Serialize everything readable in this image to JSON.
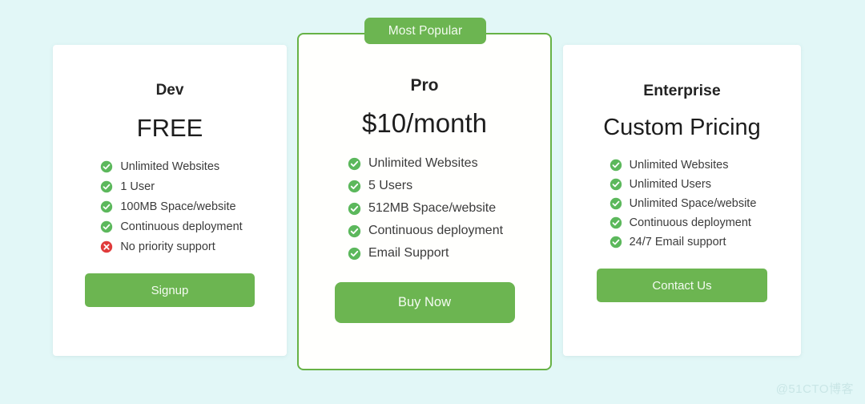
{
  "page": {
    "background_color": "#e2f7f7",
    "accent_green": "#6cb551",
    "border_green": "#67b246",
    "icon_check_color": "#5cb85c",
    "icon_cross_color": "#e03a3a",
    "watermark": "@51CTO博客"
  },
  "plans": [
    {
      "id": "dev",
      "name": "Dev",
      "price": "FREE",
      "featured": false,
      "features": [
        {
          "icon": "check-circle-icon",
          "label": "Unlimited Websites",
          "included": true
        },
        {
          "icon": "check-circle-icon",
          "label": "1 User",
          "included": true
        },
        {
          "icon": "check-circle-icon",
          "label": "100MB Space/website",
          "included": true
        },
        {
          "icon": "check-circle-icon",
          "label": "Continuous deployment",
          "included": true
        },
        {
          "icon": "cross-circle-icon",
          "label": "No priority support",
          "included": false
        }
      ],
      "cta_label": "Signup"
    },
    {
      "id": "pro",
      "name": "Pro",
      "price": "$10/month",
      "featured": true,
      "badge_label": "Most Popular",
      "features": [
        {
          "icon": "check-circle-icon",
          "label": "Unlimited Websites",
          "included": true
        },
        {
          "icon": "check-circle-icon",
          "label": "5 Users",
          "included": true
        },
        {
          "icon": "check-circle-icon",
          "label": "512MB Space/website",
          "included": true
        },
        {
          "icon": "check-circle-icon",
          "label": "Continuous deployment",
          "included": true
        },
        {
          "icon": "check-circle-icon",
          "label": "Email Support",
          "included": true
        }
      ],
      "cta_label": "Buy Now"
    },
    {
      "id": "enterprise",
      "name": "Enterprise",
      "price": "Custom Pricing",
      "featured": false,
      "features": [
        {
          "icon": "check-circle-icon",
          "label": "Unlimited Websites",
          "included": true
        },
        {
          "icon": "check-circle-icon",
          "label": "Unlimited Users",
          "included": true
        },
        {
          "icon": "check-circle-icon",
          "label": "Unlimited Space/website",
          "included": true
        },
        {
          "icon": "check-circle-icon",
          "label": "Continuous deployment",
          "included": true
        },
        {
          "icon": "check-circle-icon",
          "label": "24/7 Email support",
          "included": true
        }
      ],
      "cta_label": "Contact Us"
    }
  ]
}
